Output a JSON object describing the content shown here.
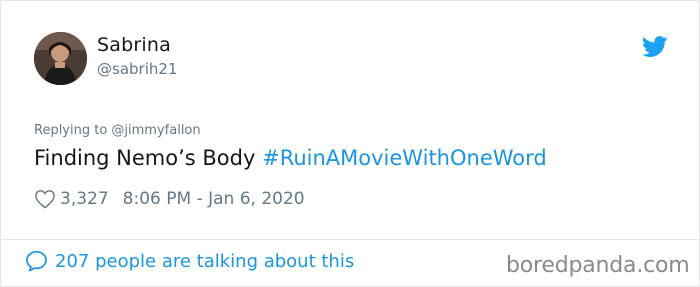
{
  "colors": {
    "accent": "#1b95e0",
    "text_primary": "#14171a",
    "text_secondary": "#657786",
    "border": "#e1e8ed",
    "watermark": "#8a8a8a"
  },
  "user": {
    "display_name": "Sabrina",
    "handle": "@sabrih21",
    "avatar_icon": "profile-photo"
  },
  "tweet": {
    "reply_to": "Replying to @jimmyfallon",
    "text": "Finding Nemo’s Body ",
    "hashtag": "#RuinAMovieWithOneWord",
    "likes": "3,327",
    "timestamp": "8:06 PM - Jan 6, 2020"
  },
  "footer": {
    "talking": "207 people are talking about this",
    "watermark": "boredpanda.com"
  },
  "icons": {
    "brand": "twitter-bird-icon",
    "like": "heart-outline-icon",
    "conversation": "speech-bubble-icon"
  }
}
